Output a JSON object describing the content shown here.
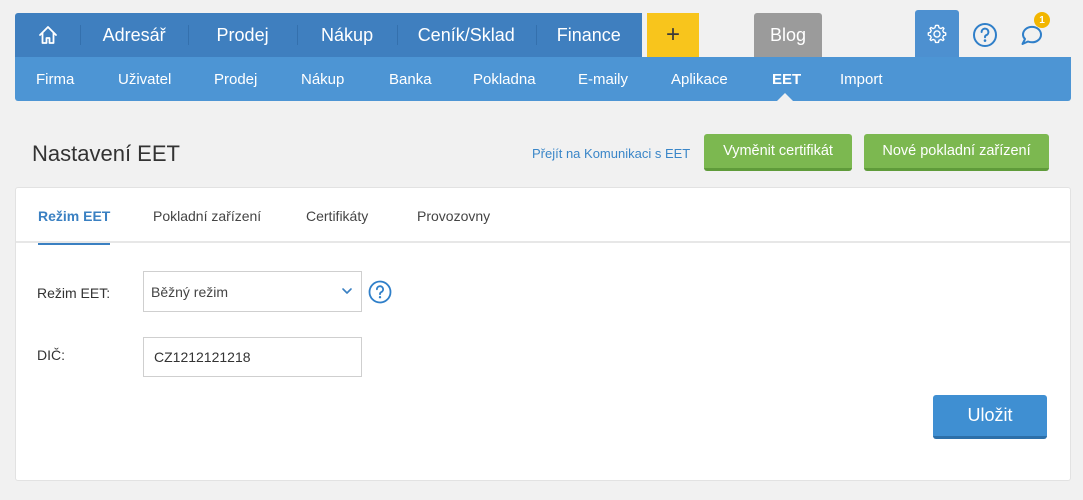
{
  "main_nav": {
    "items": [
      "Adresář",
      "Prodej",
      "Nákup",
      "Ceník/Sklad",
      "Finance"
    ],
    "plus_label": "+",
    "blog_label": "Blog",
    "notification_count": "1"
  },
  "sub_nav": {
    "items": [
      "Firma",
      "Uživatel",
      "Prodej",
      "Nákup",
      "Banka",
      "Pokladna",
      "E-maily",
      "Aplikace",
      "EET",
      "Import"
    ],
    "active": "EET"
  },
  "page": {
    "title": "Nastavení EET",
    "link_label": "Přejít na Komunikaci s EET",
    "btn_replace_cert": "Vyměnit certifikát",
    "btn_new_device": "Nové pokladní zařízení"
  },
  "tabs": {
    "items": [
      "Režim EET",
      "Pokladní zařízení",
      "Certifikáty",
      "Provozovny"
    ],
    "active": "Režim EET"
  },
  "form": {
    "mode_label": "Režim EET:",
    "mode_value": "Běžný režim",
    "dic_label": "DIČ:",
    "dic_value": "CZ1212121218",
    "save_label": "Uložit"
  },
  "colors": {
    "nav_dark": "#3f7fbf",
    "nav_light": "#4d95d4",
    "accent_yellow": "#f8c51c",
    "green_button": "#7cb850",
    "save_blue": "#3f8fd2"
  }
}
